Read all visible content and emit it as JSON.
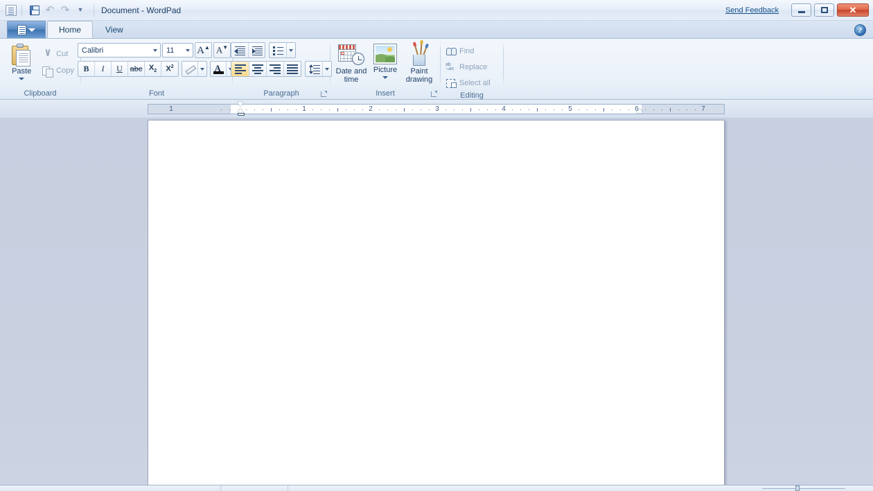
{
  "window": {
    "title": "Document - WordPad",
    "app_icon": "wordpad-document-icon",
    "send_feedback": "Send Feedback",
    "minimize_label": "Minimize",
    "maximize_label": "Maximize",
    "close_label": "Close",
    "help_label": "?"
  },
  "quick_access": {
    "items": [
      {
        "name": "save-button",
        "icon": "floppy-disk-icon",
        "label": "Save"
      },
      {
        "name": "undo-button",
        "icon": "undo-arrow-icon",
        "label": "Undo"
      },
      {
        "name": "redo-button",
        "icon": "redo-arrow-icon",
        "label": "Redo"
      },
      {
        "name": "customize-qat-button",
        "icon": "chevron-down-icon",
        "label": "Customize Quick Access Toolbar"
      }
    ]
  },
  "tabs": {
    "app_menu_label": "WordPad menu",
    "items": [
      {
        "label": "Home",
        "active": true
      },
      {
        "label": "View",
        "active": false
      }
    ]
  },
  "ribbon": {
    "groups": [
      {
        "id": "clipboard",
        "label": "Clipboard",
        "paste_label": "Paste",
        "cut_label": "Cut",
        "copy_label": "Copy"
      },
      {
        "id": "font",
        "label": "Font",
        "font_family_value": "Calibri",
        "font_size_value": "11",
        "grow_font_label": "A",
        "shrink_font_label": "A",
        "bold_label": "B",
        "italic_label": "I",
        "underline_label": "U",
        "strikethrough_label": "abc",
        "subscript_label": "X",
        "subscript_sub": "2",
        "superscript_label": "X",
        "superscript_sup": "2",
        "highlight_label": "Text highlight color",
        "fontcolor_label": "A"
      },
      {
        "id": "paragraph",
        "label": "Paragraph",
        "decrease_indent_label": "Decrease indent",
        "increase_indent_label": "Increase indent",
        "bullets_label": "Start a list",
        "align_left_label": "Align left",
        "align_center_label": "Center",
        "align_right_label": "Align right",
        "justify_label": "Justify",
        "line_spacing_label": "Line spacing"
      },
      {
        "id": "insert",
        "label": "Insert",
        "date_time_label": "Date and time",
        "picture_label": "Picture",
        "paint_drawing_label": "Paint drawing"
      },
      {
        "id": "editing",
        "label": "Editing",
        "find_label": "Find",
        "replace_label": "Replace",
        "select_all_label": "Select all"
      }
    ]
  },
  "ruler": {
    "unit": "inches",
    "numbers": [
      "1",
      "1",
      "2",
      "3",
      "4",
      "5",
      "7"
    ],
    "left_indent_position_in": "0",
    "right_indent_position_in": "6",
    "visible_extent_in": "7"
  },
  "document": {
    "content": "",
    "page_color": "#ffffff"
  },
  "colors": {
    "accent": "#3f74b1",
    "titlebar_text": "#1c3d66",
    "close_button": "#c7442a",
    "group_label": "#4b6c93",
    "page_background": "#c9d1e1"
  }
}
